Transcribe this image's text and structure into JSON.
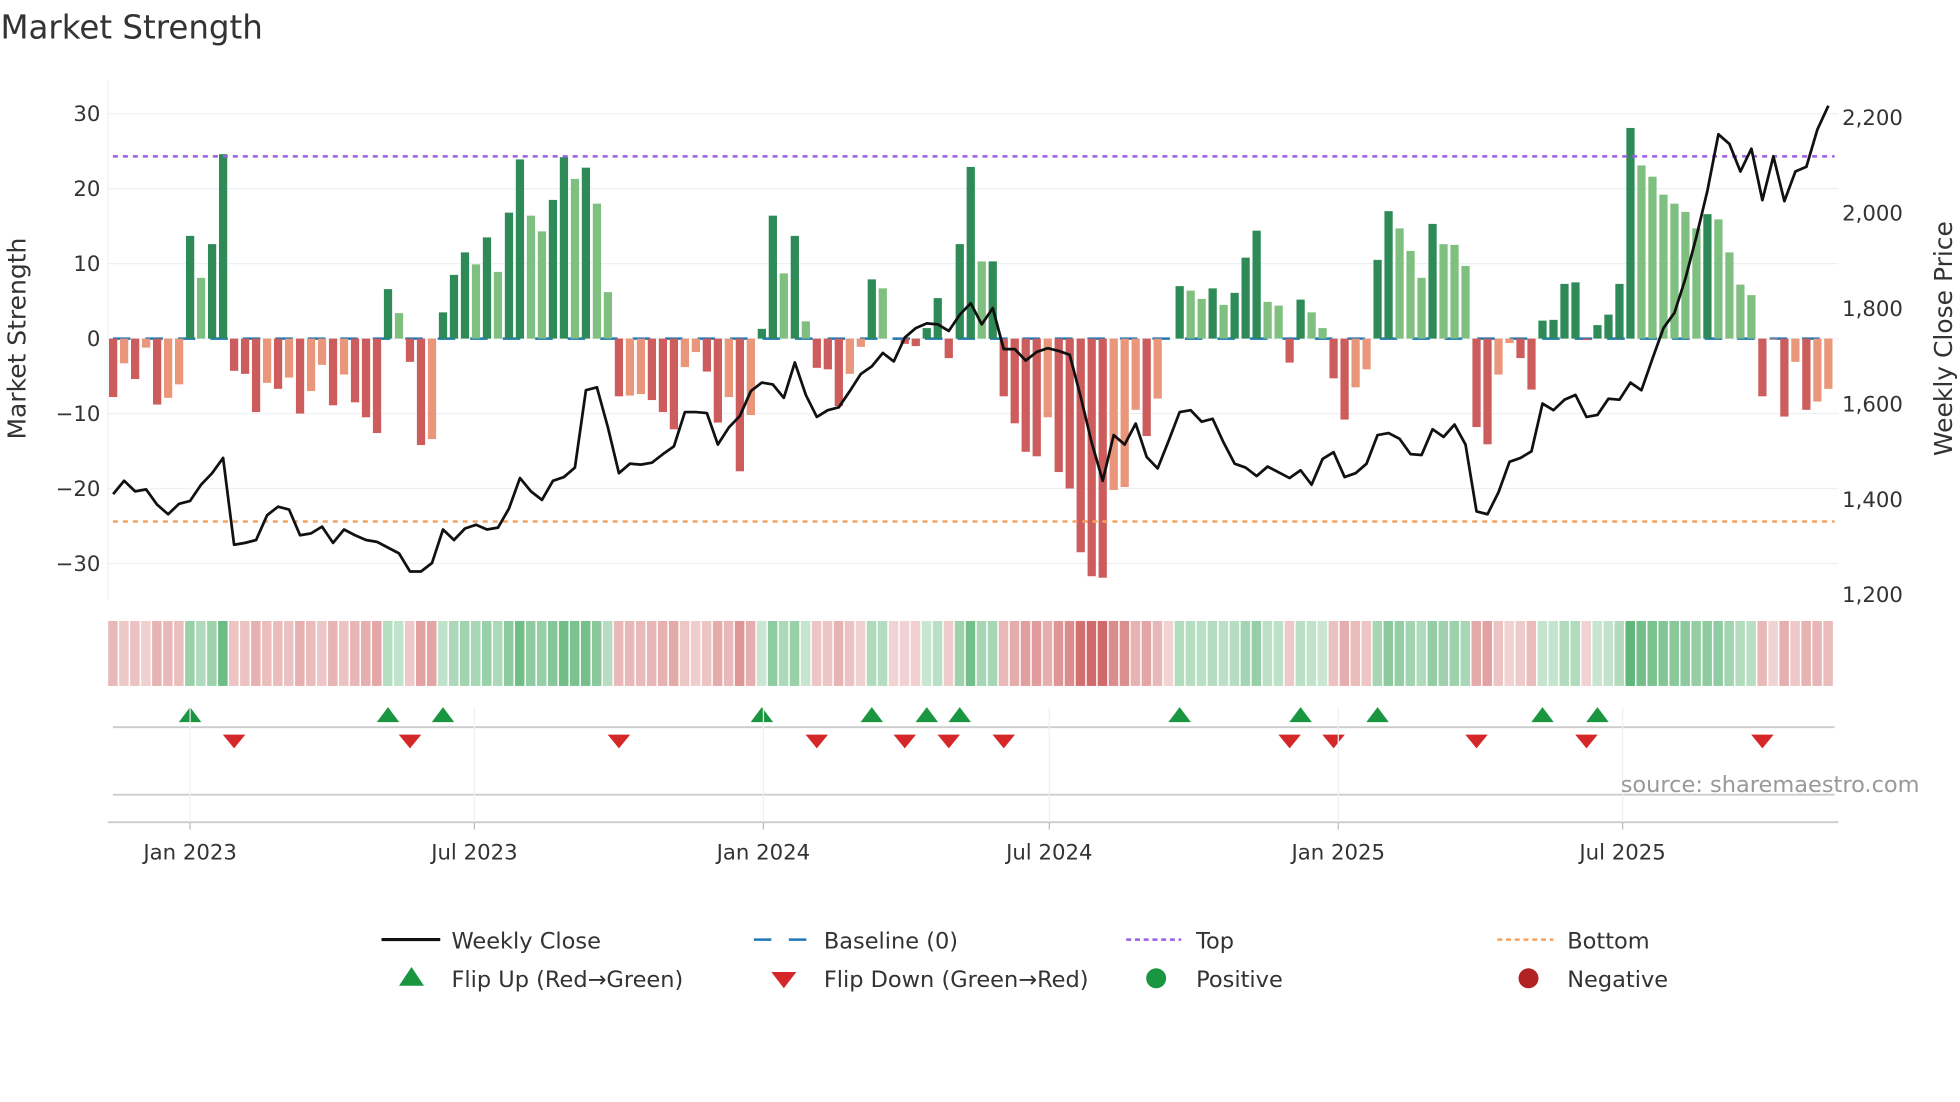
{
  "chart_data": {
    "type": "bar",
    "title": "Market Strength",
    "ylabel": "Market Strength",
    "y2label": "Weekly Close Price",
    "ylim": [
      -36,
      33
    ],
    "y2lim": [
      1180,
      2270
    ],
    "yticks": [
      30,
      20,
      10,
      0,
      -10,
      -20,
      -30
    ],
    "yticklabels": [
      "30",
      "20",
      "10",
      "0",
      "−10",
      "−20",
      "−30"
    ],
    "y2ticks": [
      2200,
      2000,
      1800,
      1600,
      1400,
      1200
    ],
    "y2ticklabels": [
      "2,200",
      "2,000",
      "1,800",
      "1,600",
      "1,400",
      "1,200"
    ],
    "x_start_date": "2022-11-13",
    "frequency": "weekly",
    "xticks": [
      {
        "date": "2023-01-01",
        "label": "Jan 2023"
      },
      {
        "date": "2023-07-01",
        "label": "Jul 2023"
      },
      {
        "date": "2024-01-01",
        "label": "Jan 2024"
      },
      {
        "date": "2024-07-01",
        "label": "Jul 2024"
      },
      {
        "date": "2025-01-01",
        "label": "Jan 2025"
      },
      {
        "date": "2025-07-01",
        "label": "Jul 2025"
      }
    ],
    "top": 24.3,
    "bottom": -24.4,
    "baseline": 0,
    "strength": [
      -7.8,
      -3.3,
      -5.4,
      -1.2,
      -8.8,
      -7.9,
      -6.1,
      13.7,
      8.1,
      12.6,
      24.6,
      -4.3,
      -4.7,
      -9.8,
      -5.9,
      -6.7,
      -5.2,
      -10,
      -7,
      -3.5,
      -8.9,
      -4.8,
      -8.5,
      -10.5,
      -12.6,
      6.6,
      3.4,
      -3.1,
      -14.2,
      -13.4,
      3.5,
      8.5,
      11.5,
      9.9,
      13.5,
      8.9,
      16.8,
      23.9,
      16.4,
      14.3,
      18.5,
      24.2,
      21.3,
      22.8,
      18,
      6.2,
      -7.7,
      -7.6,
      -7.4,
      -8.2,
      -9.8,
      -12.1,
      -3.8,
      -1.8,
      -4.4,
      -11.2,
      -7.8,
      -17.7,
      -10.2,
      1.3,
      16.4,
      8.7,
      13.7,
      2.3,
      -3.9,
      -4.1,
      -9,
      -4.7,
      -1.1,
      7.9,
      6.7,
      0,
      -0.7,
      -1,
      1.4,
      5.4,
      -2.6,
      12.6,
      22.9,
      10.3,
      10.3,
      -7.7,
      -11.3,
      -15.1,
      -15.7,
      -10.5,
      -17.8,
      -20,
      -28.5,
      -31.7,
      -31.9,
      -20.2,
      -19.8,
      -9.5,
      -13,
      -8,
      0,
      7,
      6.4,
      5.3,
      6.7,
      4.5,
      6.1,
      10.8,
      14.4,
      4.9,
      4.4,
      -3.2,
      5.2,
      3.5,
      1.4,
      -5.3,
      -10.8,
      -6.5,
      -4.1,
      10.5,
      17,
      14.7,
      11.7,
      8.1,
      15.3,
      12.6,
      12.5,
      9.7,
      -11.8,
      -14.1,
      -4.8,
      -0.6,
      -2.6,
      -6.8,
      2.4,
      2.5,
      7.3,
      7.5,
      -0.2,
      1.8,
      3.2,
      7.3,
      28.1,
      23.1,
      21.6,
      19.2,
      18,
      16.9,
      14.7,
      16.6,
      15.9,
      11.5,
      7.2,
      5.8,
      -7.7,
      -0.1,
      -10.4,
      -3.1,
      -9.5,
      -8.4,
      -6.7
    ],
    "close": [
      1408,
      1436,
      1414,
      1418,
      1386,
      1366,
      1388,
      1394,
      1428,
      1452,
      1484,
      1302,
      1306,
      1312,
      1364,
      1382,
      1376,
      1322,
      1326,
      1340,
      1306,
      1334,
      1322,
      1312,
      1308,
      1296,
      1284,
      1246,
      1246,
      1264,
      1334,
      1312,
      1336,
      1344,
      1334,
      1338,
      1378,
      1442,
      1414,
      1396,
      1436,
      1444,
      1464,
      1626,
      1632,
      1548,
      1452,
      1472,
      1470,
      1474,
      1492,
      1508,
      1580,
      1580,
      1578,
      1512,
      1548,
      1572,
      1624,
      1642,
      1638,
      1610,
      1684,
      1616,
      1570,
      1584,
      1590,
      1624,
      1660,
      1676,
      1704,
      1686,
      1736,
      1756,
      1766,
      1764,
      1750,
      1784,
      1808,
      1764,
      1798,
      1712,
      1712,
      1688,
      1706,
      1714,
      1708,
      1700,
      1612,
      1516,
      1436,
      1532,
      1512,
      1556,
      1486,
      1462,
      1520,
      1580,
      1584,
      1560,
      1566,
      1516,
      1472,
      1464,
      1446,
      1466,
      1454,
      1442,
      1458,
      1428,
      1482,
      1496,
      1444,
      1452,
      1472,
      1532,
      1536,
      1524,
      1492,
      1490,
      1544,
      1528,
      1554,
      1512,
      1372,
      1366,
      1412,
      1476,
      1484,
      1498,
      1598,
      1584,
      1606,
      1616,
      1570,
      1574,
      1608,
      1606,
      1642,
      1626,
      1692,
      1756,
      1788,
      1860,
      1948,
      2044,
      2162,
      2142,
      2084,
      2132,
      2024,
      2116,
      2022,
      2084,
      2094,
      2172,
      2222
    ],
    "flip_up_weeks": [
      7,
      25,
      30,
      59,
      69,
      74,
      77,
      97,
      108,
      115,
      130,
      135
    ],
    "flip_down_weeks": [
      11,
      27,
      46,
      64,
      72,
      76,
      81,
      107,
      111,
      124,
      134,
      150
    ],
    "legend": {
      "placement": "bottom",
      "items": [
        {
          "label": "Weekly Close",
          "symbol": "line"
        },
        {
          "label": "Baseline (0)",
          "symbol": "dash"
        },
        {
          "label": "Top",
          "symbol": "dot-purple"
        },
        {
          "label": "Bottom",
          "symbol": "dot-orange"
        },
        {
          "label": "Flip Up (Red→Green)",
          "symbol": "triangle-up"
        },
        {
          "label": "Flip Down (Green→Red)",
          "symbol": "triangle-down"
        },
        {
          "label": "Positive",
          "symbol": "circle-green"
        },
        {
          "label": "Negative",
          "symbol": "circle-red"
        }
      ]
    },
    "colors": {
      "pos_strong": "#2e8b57",
      "pos_weak": "#7fbf7f",
      "neg_strong": "#cd5c5c",
      "neg_weak": "#e9967a",
      "top": "#9b5de5",
      "bottom": "#f4a261",
      "baseline": "#1f77b4",
      "close": "#111111",
      "flip_up": "#1a9641",
      "flip_down": "#d62728",
      "positive": "#1a9641",
      "negative": "#b22222"
    }
  },
  "source": "source: sharemaestro.com"
}
